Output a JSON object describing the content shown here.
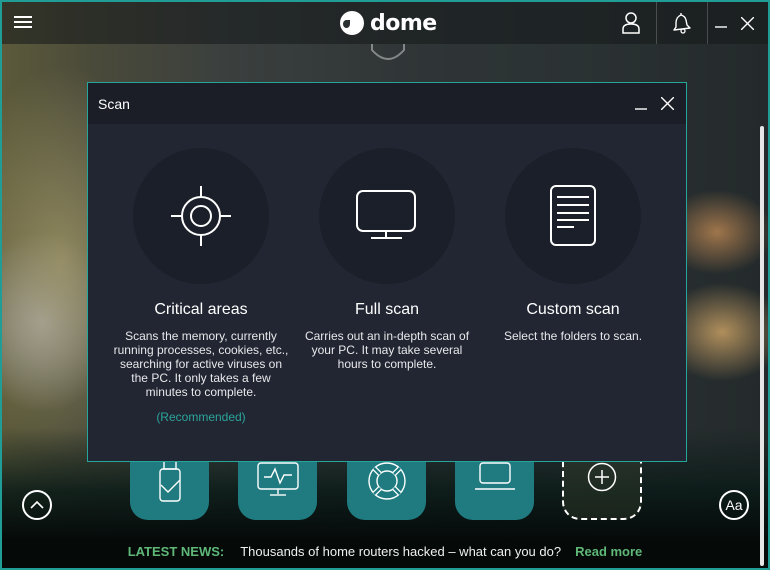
{
  "app": {
    "logo_text": "dome",
    "brand_color": "#1f9d96",
    "accent_color": "#26a69a"
  },
  "titlebar": {
    "menu_icon": "hamburger-icon",
    "account_icon": "user-icon",
    "notifications_icon": "bell-icon",
    "minimize_icon": "minimize-icon",
    "close_icon": "close-icon"
  },
  "dialog": {
    "title": "Scan",
    "options": [
      {
        "icon": "crosshair-icon",
        "title": "Critical areas",
        "description": "Scans the memory, currently running processes, cookies, etc., searching for active viruses on the PC. It only takes a few minutes to complete.",
        "note": "(Recommended)"
      },
      {
        "icon": "monitor-icon",
        "title": "Full scan",
        "description": "Carries out an in-depth scan of your PC. It may take several hours to complete."
      },
      {
        "icon": "document-icon",
        "title": "Custom scan",
        "description": "Select the folders to scan."
      }
    ]
  },
  "tiles": [
    {
      "icon": "usb-shield-icon"
    },
    {
      "icon": "monitor-pulse-icon"
    },
    {
      "icon": "lifebuoy-icon"
    },
    {
      "icon": "laptop-icon"
    },
    {
      "icon": "add-icon"
    }
  ],
  "controls": {
    "collapse_icon": "chevron-up-icon",
    "font_size_label": "Aa"
  },
  "news": {
    "label": "LATEST NEWS:",
    "headline": "Thousands of home routers hacked – what can you do?",
    "link": "Read more"
  }
}
